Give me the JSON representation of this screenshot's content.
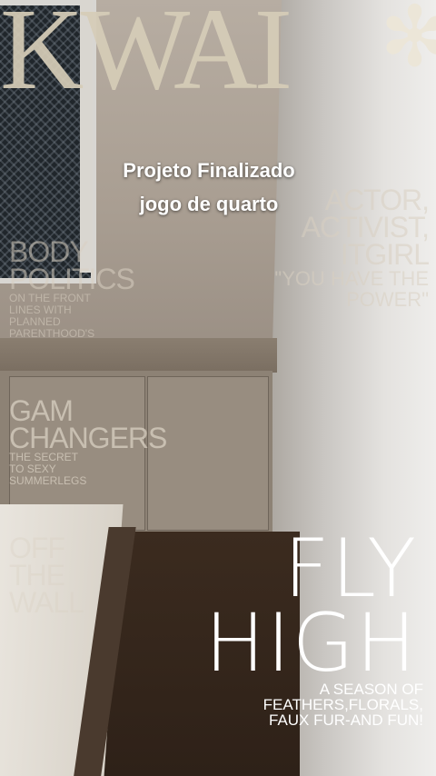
{
  "masthead": {
    "title": "KWAI",
    "icon": "asterisk-icon"
  },
  "caption": {
    "line1": "Projeto Finalizado",
    "line2": "jogo de quarto"
  },
  "cover_lines": {
    "actor": [
      "ACTOR,",
      "ACTIVIST,",
      "ITGIRL",
      "\"YOU HAVE THE",
      "POWER\""
    ],
    "body_politics": {
      "title1": "BODY",
      "title2": "POLITICS",
      "sub": [
        "ON THE FRONT",
        "LINES WITH",
        "PLANNED",
        "PARENTHOOD'S"
      ]
    },
    "gam_changers": {
      "title1": "GAM",
      "title2": "CHANGERS",
      "sub": [
        "THE SECRET",
        "TO SEXY",
        "SUMMERLEGS"
      ]
    },
    "off_the_wall": [
      "OFF",
      "THE",
      "WALL"
    ]
  },
  "feature": {
    "line1": "FLY",
    "line2": "HIGH",
    "sub": [
      "A SEASON OF",
      "FEATHERS,FLORALS,",
      "FAUX FUR-AND FUN!"
    ]
  },
  "colors": {
    "masthead": "#d6cdb8",
    "caption": "#ffffff",
    "feature": "#ffffff"
  }
}
